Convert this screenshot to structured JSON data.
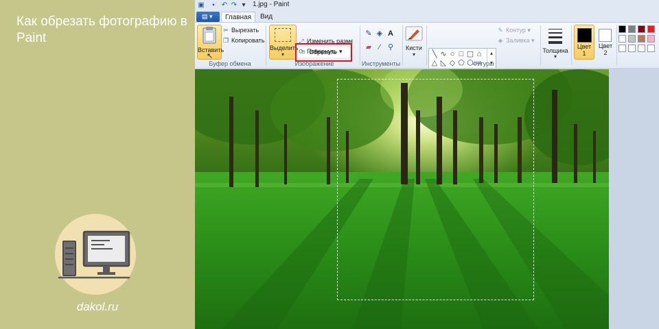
{
  "article": {
    "title": "Как обрезать фотографию в Paint",
    "site": "dakol.ru"
  },
  "window": {
    "title": "1.jpg - Paint"
  },
  "tabs": [
    {
      "label": "Главная",
      "active": true
    },
    {
      "label": "Вид",
      "active": false
    }
  ],
  "ribbon": {
    "clipboard": {
      "label": "Буфер обмена",
      "paste": "Вставить",
      "cut": "Вырезать",
      "copy": "Копировать"
    },
    "image": {
      "label": "Изображение",
      "select": "Выделить",
      "crop": "Обрезать",
      "resize": "Изменить размер",
      "rotate": "Повернуть"
    },
    "tools": {
      "label": "Инструменты"
    },
    "brushes": {
      "label": "Кисти"
    },
    "shapes": {
      "label": "Фигуры",
      "outline": "Контур",
      "fill": "Заливка"
    },
    "size": {
      "label": "Толщина"
    },
    "colors": {
      "color1": "Цвет",
      "color1_num": "1",
      "color2": "Цвет",
      "color2_num": "2",
      "palette": [
        "#000000",
        "#7f7f7f",
        "#880015",
        "#ed1c24",
        "#ffffff",
        "#c3c3c3",
        "#b97a57",
        "#ffaec9",
        "#ffffff",
        "#ffffff",
        "#ffffff",
        "#ffffff"
      ]
    }
  },
  "accent": {
    "highlight": "#e0121b",
    "banner": "#c6c58a"
  }
}
